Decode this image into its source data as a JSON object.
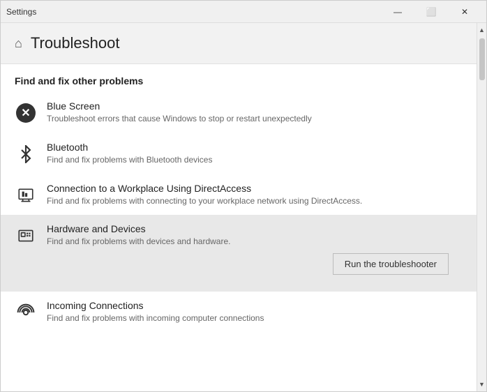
{
  "window": {
    "title": "Settings",
    "controls": {
      "minimize": "—",
      "maximize": "⬜",
      "close": "✕"
    }
  },
  "page": {
    "title": "Troubleshoot",
    "section_title": "Find and fix other problems"
  },
  "items": [
    {
      "id": "blue-screen",
      "name": "Blue Screen",
      "desc": "Troubleshoot errors that cause Windows to stop or restart unexpectedly",
      "icon_type": "bluescreen",
      "active": false
    },
    {
      "id": "bluetooth",
      "name": "Bluetooth",
      "desc": "Find and fix problems with Bluetooth devices",
      "icon_type": "bluetooth",
      "active": false
    },
    {
      "id": "connection-workplace",
      "name": "Connection to a Workplace Using DirectAccess",
      "desc": "Find and fix problems with connecting to your workplace network using DirectAccess.",
      "icon_type": "connection",
      "active": false
    },
    {
      "id": "hardware-devices",
      "name": "Hardware and Devices",
      "desc": "Find and fix problems with devices and hardware.",
      "icon_type": "hardware",
      "active": true,
      "run_button_label": "Run the troubleshooter"
    },
    {
      "id": "incoming-connections",
      "name": "Incoming Connections",
      "desc": "Find and fix problems with incoming computer connections",
      "icon_type": "incoming",
      "active": false
    }
  ]
}
